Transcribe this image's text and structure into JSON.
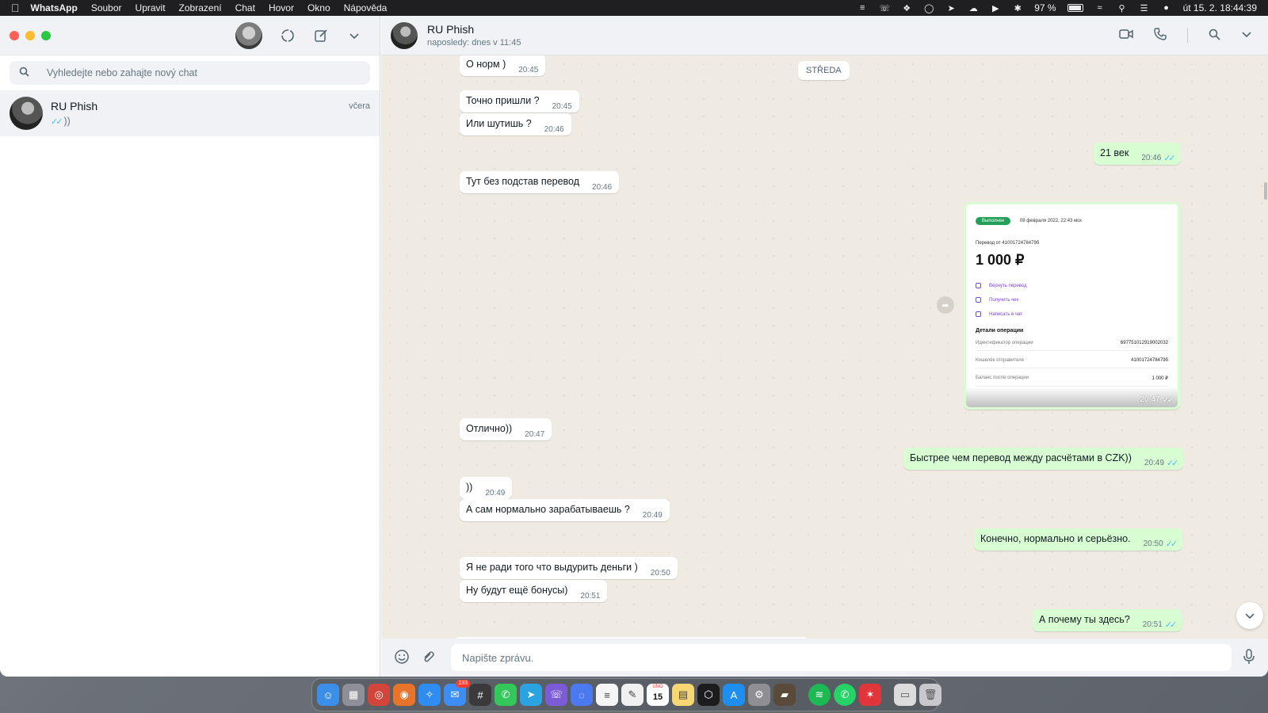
{
  "menubar": {
    "app": "WhatsApp",
    "items": [
      "Soubor",
      "Upravit",
      "Zobrazení",
      "Chat",
      "Hovor",
      "Okno",
      "Nápověda"
    ],
    "battery": "97 %",
    "datetime": "út 15. 2.  18:44:39"
  },
  "sidebar": {
    "search_placeholder": "Vyhledejte nebo zahajte nový chat",
    "chats": [
      {
        "name": "RU Phish",
        "time": "včera",
        "last": "))"
      }
    ]
  },
  "conversation": {
    "name": "RU Phish",
    "status": "naposledy: dnes v 11:45",
    "day_chip": "STŘEDA",
    "messages": [
      {
        "id": "m1",
        "dir": "in",
        "text": "О норм )",
        "time": "20:45"
      },
      {
        "id": "m2",
        "dir": "in",
        "text": "Точно пришли ?",
        "time": "20:45"
      },
      {
        "id": "m3",
        "dir": "in",
        "text": "Или шутишь ?",
        "time": "20:46"
      },
      {
        "id": "m4",
        "dir": "out",
        "text": "21 век",
        "time": "20:46"
      },
      {
        "id": "m5",
        "dir": "in",
        "text": "Тут без подстав перевод",
        "time": "20:46"
      },
      {
        "id": "m6",
        "dir": "in",
        "text": "Отлично))",
        "time": "20:47"
      },
      {
        "id": "m7",
        "dir": "out",
        "text": "Быстрее чем перевод между расчётами в CZK))",
        "time": "20:49"
      },
      {
        "id": "m8",
        "dir": "in",
        "text": "))",
        "time": "20:49"
      },
      {
        "id": "m9",
        "dir": "in",
        "text": "А сам нормально зарабатываешь ?",
        "time": "20:49"
      },
      {
        "id": "m10",
        "dir": "out",
        "text": "Конечно, нормально и серьёзно.",
        "time": "20:50"
      },
      {
        "id": "m11",
        "dir": "in",
        "text": "Я не ради того что выдурить деньги )",
        "time": "20:50"
      },
      {
        "id": "m12",
        "dir": "in",
        "text": "Ну будут ещё бонусы)",
        "time": "20:51"
      },
      {
        "id": "m13",
        "dir": "out",
        "text": "А почему ты здесь?",
        "time": "20:51"
      }
    ],
    "image_message": {
      "time": "20:47",
      "receipt": {
        "status": "Выполнен",
        "date": "09 февраля 2022, 22:43 мск",
        "from": "Перевод от 4100172478479б",
        "amount": "1 000 ₽",
        "actions": [
          "Вернуть перевод",
          "Получить чек",
          "Написать в чат"
        ],
        "details_title": "Детали операции",
        "rows": [
          {
            "label": "Идентификатор операции",
            "value": "697751012919002032"
          },
          {
            "label": "Кошелёк отправителя",
            "value": "4100172478479б"
          },
          {
            "label": "Баланс после операции",
            "value": "1 000 ₽"
          }
        ]
      }
    },
    "composer_placeholder": "Napište zprávu."
  },
  "dock": {
    "mail_badge": "233",
    "calendar_month": "ÚNO",
    "calendar_day": "15"
  },
  "colors": {
    "outgoing_bubble": "#d9fdd3",
    "incoming_bubble": "#ffffff",
    "read_ticks": "#53bdeb",
    "chat_bg": "#efeae2"
  }
}
